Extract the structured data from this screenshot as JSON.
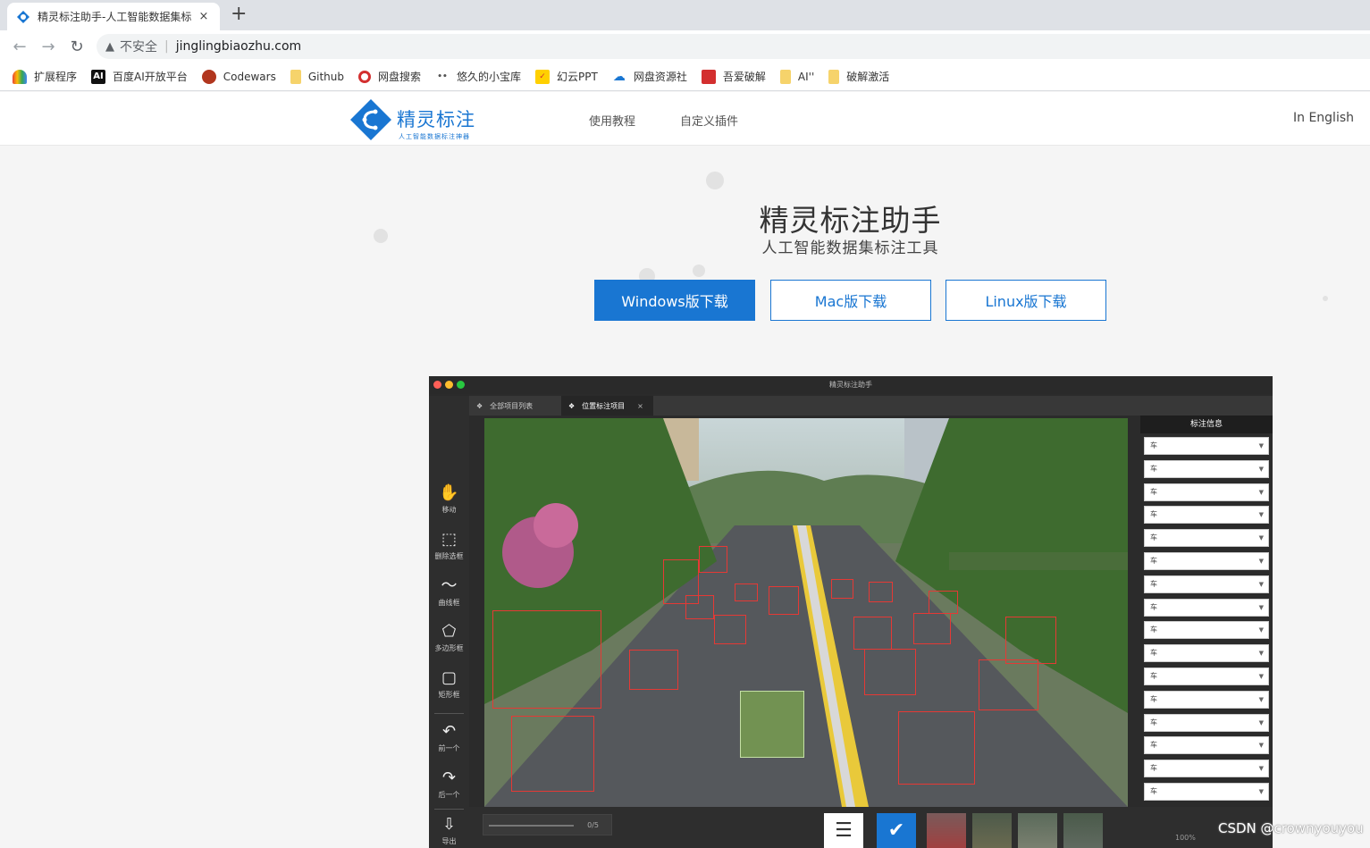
{
  "browser": {
    "tab_title": "精灵标注助手-人工智能数据集标",
    "tab_close": "×",
    "new_tab": "+",
    "insecure_label": "不安全",
    "url": "jinglingbiaozhu.com",
    "bookmarks": [
      {
        "label": "扩展程序",
        "icon": "extensions-icon"
      },
      {
        "label": "百度AI开放平台",
        "icon": "ai-icon",
        "glyph": "AI"
      },
      {
        "label": "Codewars",
        "icon": "codewars-icon"
      },
      {
        "label": "Github",
        "icon": "folder-icon"
      },
      {
        "label": "网盘搜索",
        "icon": "search-icon"
      },
      {
        "label": "悠久的小宝库",
        "icon": "link-icon"
      },
      {
        "label": "幻云PPT",
        "icon": "ppt-icon"
      },
      {
        "label": "网盘资源社",
        "icon": "cloud-icon"
      },
      {
        "label": "吾爱破解",
        "icon": "52pojie-icon"
      },
      {
        "label": "AI''",
        "icon": "folder-icon"
      },
      {
        "label": "破解激活",
        "icon": "folder-icon"
      }
    ]
  },
  "site": {
    "logo_title": "精灵标注",
    "logo_subtitle": "人工智能数据标注神器",
    "nav": [
      "使用教程",
      "自定义插件"
    ],
    "language": "In English",
    "hero_title": "精灵标注助手",
    "hero_subtitle": "人工智能数据集标注工具",
    "downloads": [
      "Windows版下载",
      "Mac版下载",
      "Linux版下载"
    ],
    "accent": "#1976d2"
  },
  "app": {
    "window_title": "精灵标注助手",
    "tabs": [
      {
        "label": "全部项目列表"
      },
      {
        "label": "位置标注项目",
        "close": "×"
      }
    ],
    "tools": [
      {
        "label": "移动",
        "icon": "hand-icon",
        "glyph": "✋"
      },
      {
        "label": "删除选框",
        "icon": "delete-box-icon",
        "glyph": "⬚"
      },
      {
        "label": "曲线框",
        "icon": "curve-icon",
        "glyph": "〜"
      },
      {
        "label": "多边形框",
        "icon": "polygon-icon",
        "glyph": "⬠"
      },
      {
        "label": "矩形框",
        "icon": "rectangle-icon",
        "glyph": "▢"
      },
      {
        "label": "前一个",
        "icon": "undo-icon",
        "glyph": "↶"
      },
      {
        "label": "后一个",
        "icon": "redo-icon",
        "glyph": "↷"
      },
      {
        "label": "导出",
        "icon": "export-icon",
        "glyph": "⇩"
      }
    ],
    "panel_title": "标注信息",
    "annotation_labels": [
      "车",
      "车",
      "车",
      "车",
      "车",
      "车",
      "车",
      "车",
      "车",
      "车",
      "车",
      "车",
      "车",
      "车",
      "车",
      "车"
    ],
    "progress_count": "0/5",
    "zoom": "100%"
  },
  "watermark": "CSDN @crownyouyou"
}
